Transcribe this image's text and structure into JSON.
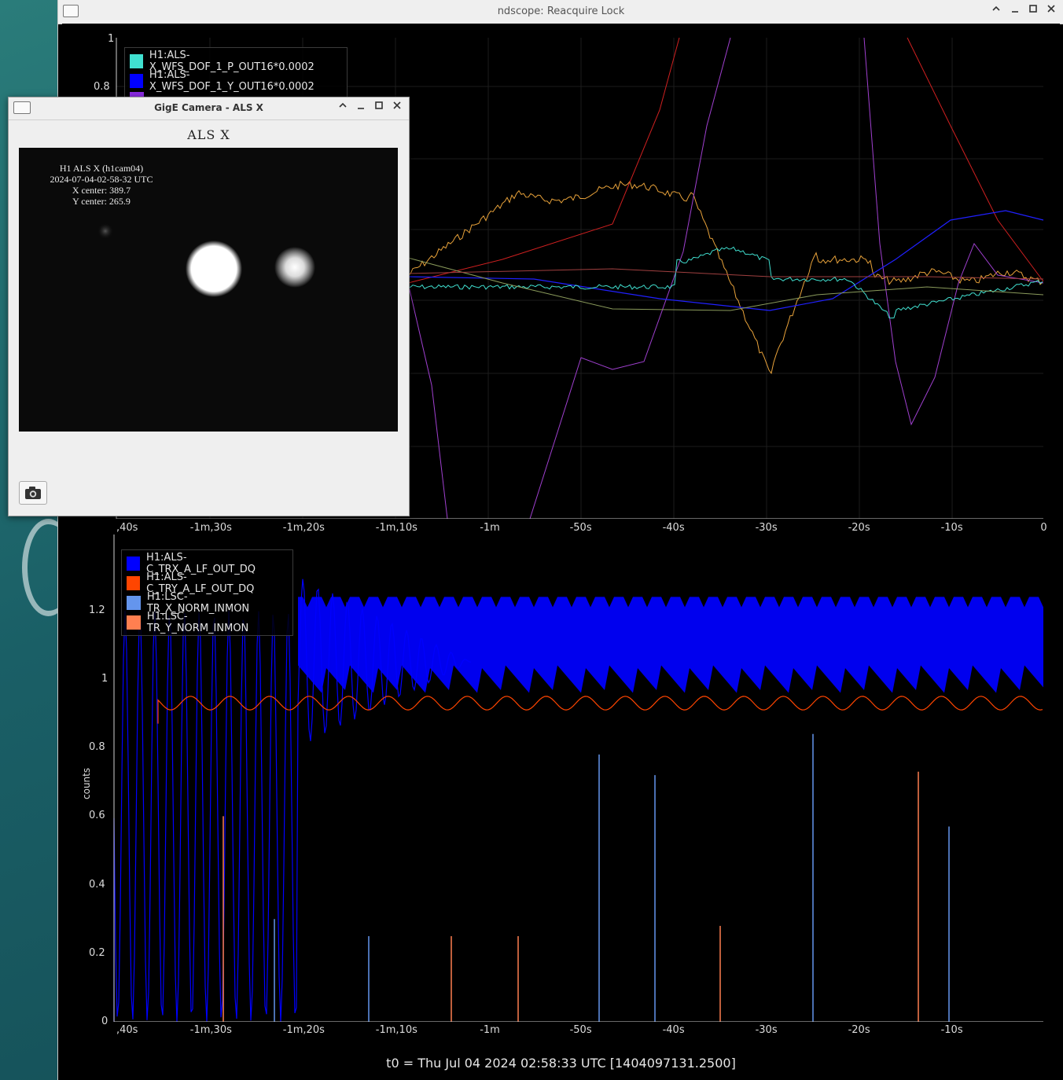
{
  "main_window": {
    "title": "ndscope: Reacquire Lock",
    "controls": {
      "minimize": "‹",
      "min": "–",
      "max": "□",
      "close": "✕"
    },
    "footer": "t0 = Thu Jul 04 2024 02:58:33 UTC [1404097131.2500]"
  },
  "top_plot": {
    "legend": [
      {
        "label": "H1:ALS-X_WFS_DOF_1_P_OUT16*0.0002",
        "color": "#40e0d0"
      },
      {
        "label": "H1:ALS-X_WFS_DOF_1_Y_OUT16*0.0002",
        "color": "#0000ff"
      }
    ],
    "y_ticks": [
      "1",
      "0.8"
    ],
    "x_ticks": [
      ",40s",
      "-1m,30s",
      "-1m,20s",
      "-1m,10s",
      "-1m",
      "-50s",
      "-40s",
      "-30s",
      "-20s",
      "-10s",
      "0"
    ]
  },
  "bottom_plot": {
    "ylabel": "counts",
    "legend": [
      {
        "label": "H1:ALS-C_TRX_A_LF_OUT_DQ",
        "color": "#0000ff"
      },
      {
        "label": "H1:ALS-C_TRY_A_LF_OUT_DQ",
        "color": "#ff4500"
      },
      {
        "label": "H1:LSC-TR_X_NORM_INMON",
        "color": "#6495ed"
      },
      {
        "label": "H1:LSC-TR_Y_NORM_INMON",
        "color": "#ff7f50"
      }
    ],
    "y_ticks": [
      "1.2",
      "1",
      "0.8",
      "0.6",
      "0.4",
      "0.2",
      "0"
    ],
    "x_ticks": [
      ",40s",
      "-1m,30s",
      "-1m,20s",
      "-1m,10s",
      "-1m",
      "-50s",
      "-40s",
      "-30s",
      "-20s",
      "-10s"
    ]
  },
  "camera_window": {
    "title": "GigE Camera - ALS X",
    "heading": "ALS X",
    "info_lines": [
      "H1 ALS X (h1cam04)",
      "2024-07-04-02-58-32 UTC",
      "X center: 389.7",
      "Y center: 265.9"
    ],
    "snapshot_icon": "camera-icon"
  }
}
